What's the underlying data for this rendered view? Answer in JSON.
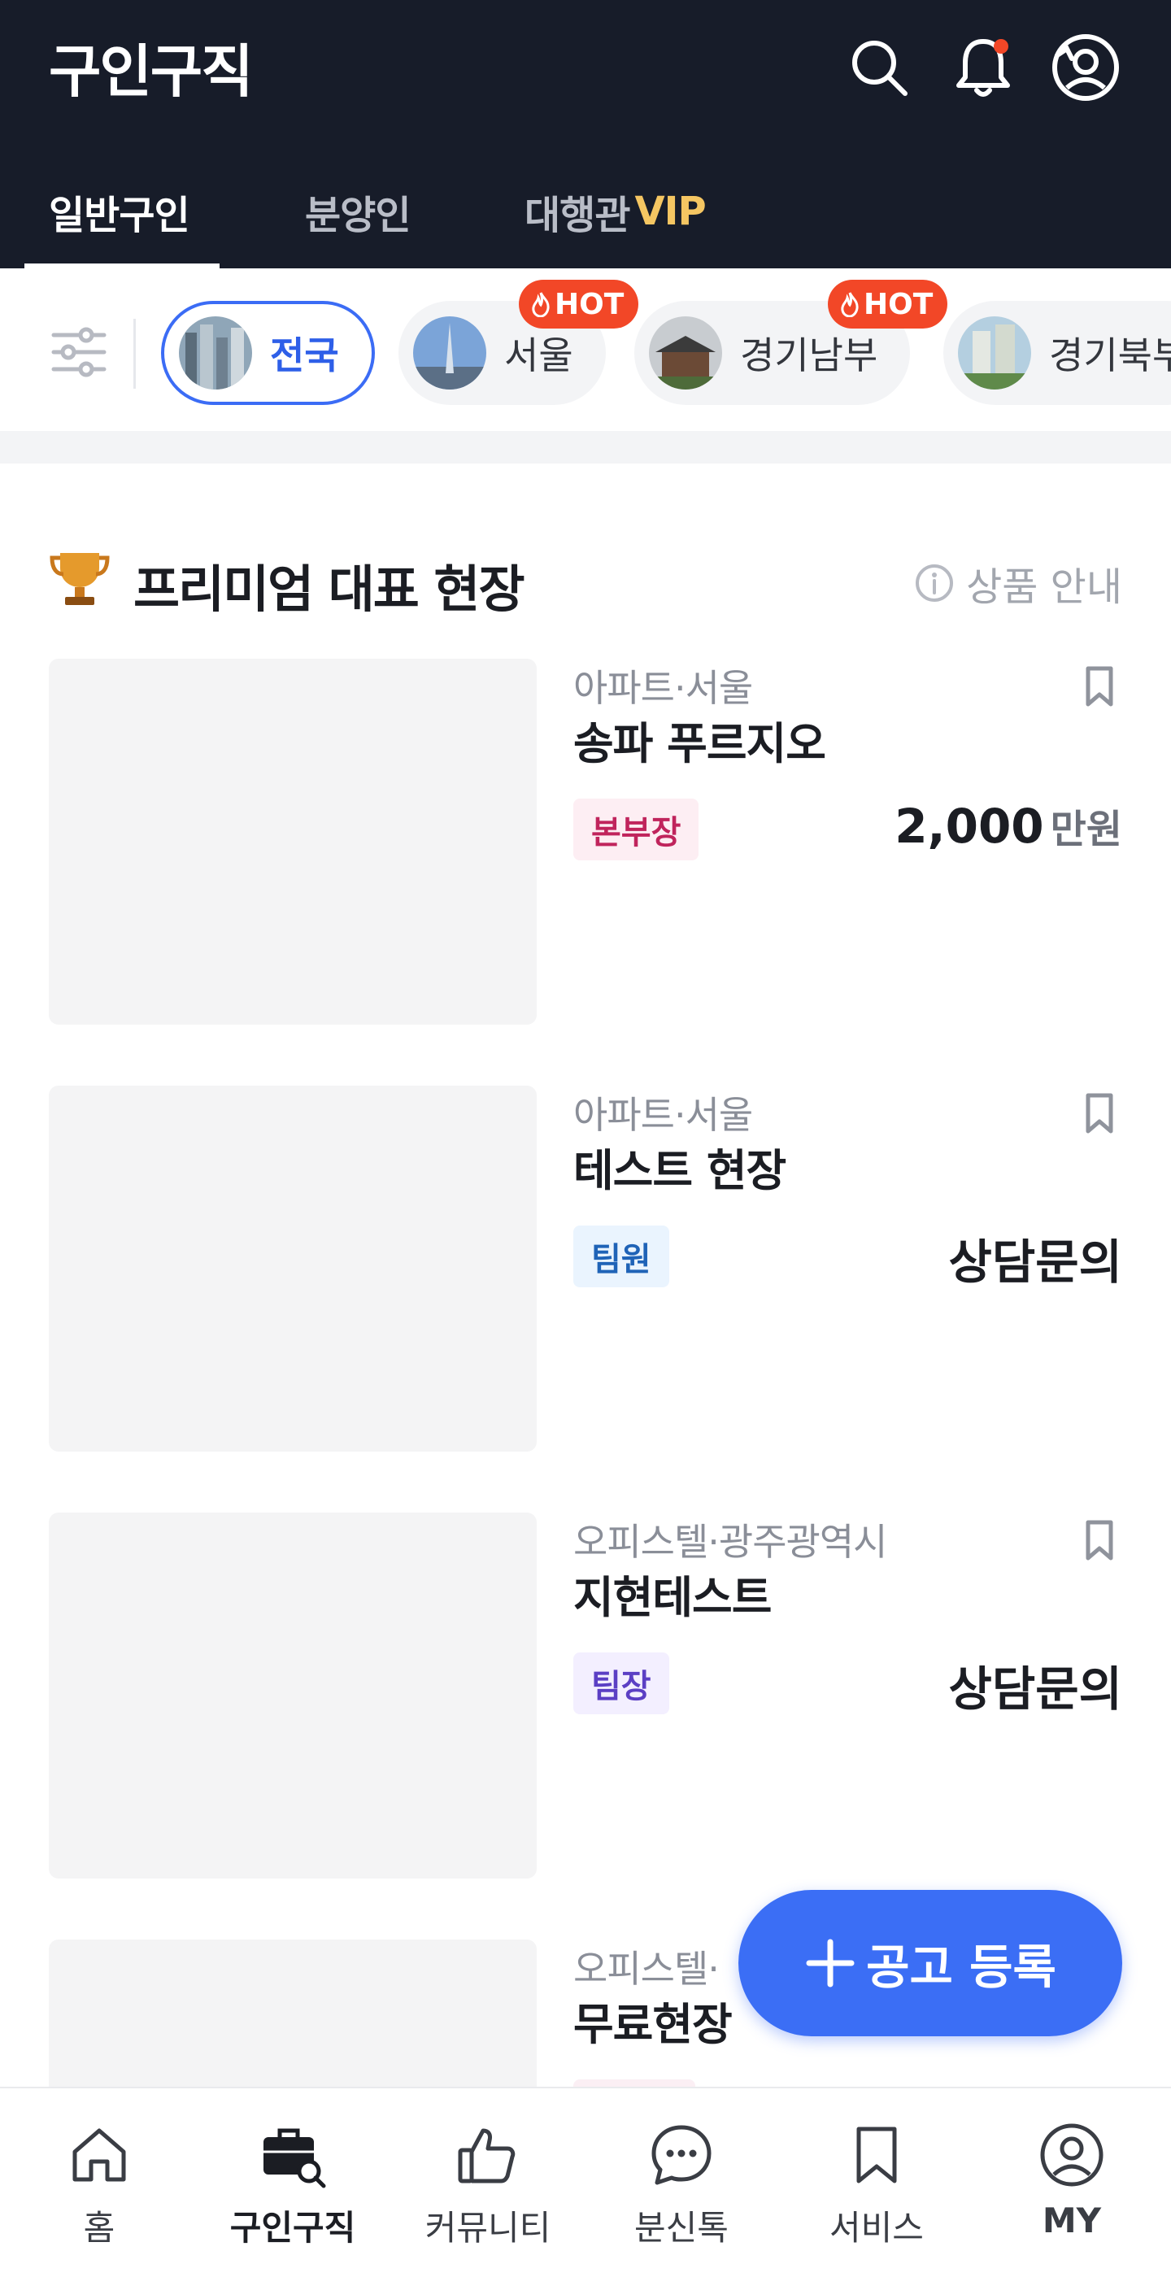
{
  "header": {
    "title": "구인구직"
  },
  "tabs": [
    {
      "label": "일반구인",
      "active": true
    },
    {
      "label": "분양인",
      "active": false
    },
    {
      "label": "대행관",
      "suffix": "VIP",
      "active": false
    }
  ],
  "regions": [
    {
      "label": "전국",
      "selected": true,
      "hot": false
    },
    {
      "label": "서울",
      "selected": false,
      "hot": true
    },
    {
      "label": "경기남부",
      "selected": false,
      "hot": true
    },
    {
      "label": "경기북부",
      "selected": false,
      "hot": false
    }
  ],
  "hot_label": "HOT",
  "section": {
    "title": "프리미엄 대표 현장",
    "info_label": "상품 안내"
  },
  "listings": [
    {
      "category": "아파트·서울",
      "name": "송파 푸르지오",
      "badge": "본부장",
      "price": "2,000",
      "unit": "만원"
    },
    {
      "category": "아파트·서울",
      "name": "테스트 현장",
      "badge": "팀원",
      "price": "상담문의",
      "unit": ""
    },
    {
      "category": "오피스텔·광주광역시",
      "name": "지현테스트",
      "badge": "팀장",
      "price": "상담문의",
      "unit": ""
    },
    {
      "category": "오피스텔·",
      "name": "무료현장",
      "badge": "",
      "price": "",
      "unit": ""
    }
  ],
  "fab": {
    "label": "공고 등록"
  },
  "bottom_nav": [
    {
      "label": "홈",
      "icon": "home-icon",
      "active": false
    },
    {
      "label": "구인구직",
      "icon": "briefcase-search-icon",
      "active": true
    },
    {
      "label": "커뮤니티",
      "icon": "thumbs-up-icon",
      "active": false
    },
    {
      "label": "분신톡",
      "icon": "chat-bubble-icon",
      "active": false
    },
    {
      "label": "서비스",
      "icon": "bookmark-icon",
      "active": false
    },
    {
      "label": "MY",
      "icon": "user-circle-icon",
      "active": false
    }
  ],
  "colors": {
    "header_bg": "#171c29",
    "accent": "#3b6ef5",
    "hot": "#f24727",
    "vip": "#f5c662"
  }
}
